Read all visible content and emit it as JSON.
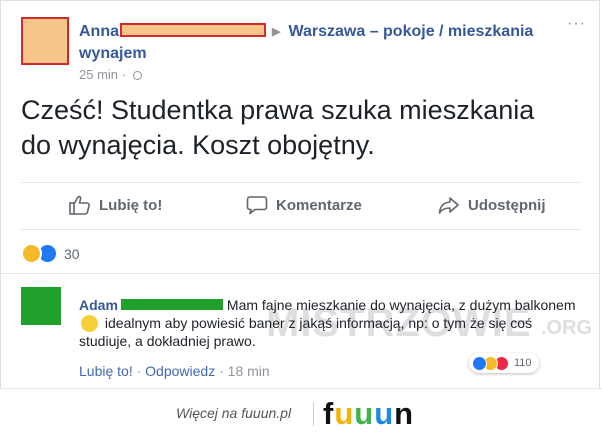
{
  "post": {
    "author": "Anna",
    "group": "Warszawa – pokoje / mieszkania",
    "group_cont": "wynajem",
    "time": "25 min",
    "more": "···",
    "text_line1": "Cześć! Studentka prawa szuka mieszkania",
    "text_line2": "do wynajęcia. Koszt obojętny."
  },
  "actions": {
    "like": "Lubię to!",
    "comment": "Komentarze",
    "share": "Udostępnij"
  },
  "reactions": {
    "count": "30"
  },
  "comment": {
    "author": "Adam",
    "text_a": "Mam fajne mieszkanie do wynajęcia, z dużym balkonem",
    "text_b": "idealnym aby powiesić baner z jakąś informacją, np: o tym że się coś studiuje, a dokładniej prawo.",
    "like": "Lubię to!",
    "reply": "Odpowiedz",
    "time": "18 min",
    "reaction_count": "110"
  },
  "watermark": {
    "main": "MISTRZOWIE",
    "suffix": ".ORG"
  },
  "footer": {
    "more_on": "Więcej na fuuun.pl",
    "logo": "fuuun",
    "logo_colors": [
      "#111111",
      "#f5b200",
      "#3bb54a",
      "#1e88e5",
      "#111111"
    ]
  },
  "colors": {
    "link": "#365899",
    "redact_fill": "#f7c58a",
    "redact_border": "#d12c2c",
    "comment_redact": "#1fa12c"
  }
}
